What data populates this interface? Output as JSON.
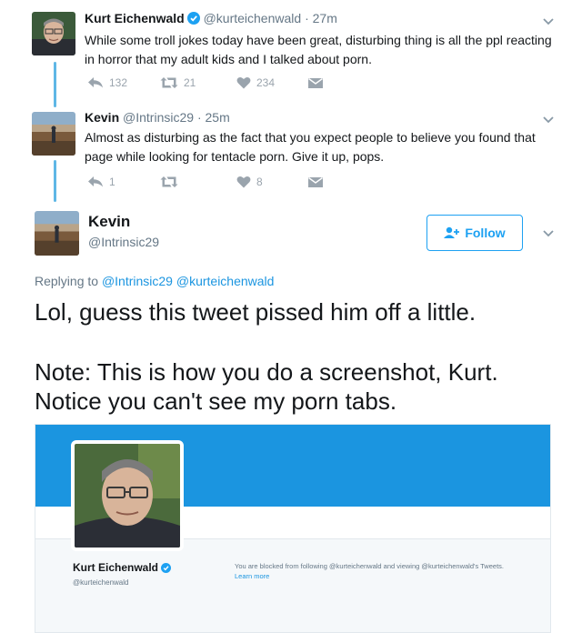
{
  "tweet1": {
    "name": "Kurt Eichenwald",
    "handle": "@kurteichenwald",
    "time": "27m",
    "text": "While some troll jokes today have been great, disturbing thing is all the ppl reacting in horror that my adult kids and I talked about porn.",
    "replies": "132",
    "retweets": "21",
    "likes": "234"
  },
  "tweet2": {
    "name": "Kevin",
    "handle": "@Intrinsic29",
    "time": "25m",
    "text": "Almost as disturbing as the fact that you expect people to believe you found that page while looking for tentacle porn. Give it up, pops.",
    "replies": "1",
    "retweets": "",
    "likes": "8"
  },
  "main_tweet": {
    "name": "Kevin",
    "handle": "@Intrinsic29",
    "follow_label": "Follow",
    "replying_prefix": "Replying to",
    "reply_to_1": "@Intrinsic29",
    "reply_to_2": "@kurteichenwald",
    "text_line1": "Lol, guess this tweet pissed him off a little.",
    "text_line2": "Note: This is how you do a screenshot, Kurt.",
    "text_line3": "Notice you can't see my porn tabs."
  },
  "embedded_card": {
    "name": "Kurt Eichenwald",
    "handle": "@kurteichenwald",
    "blocked_text": "You are blocked from following @kurteichenwald and viewing @kurteichenwald's Tweets.",
    "learn_more": "Learn more"
  },
  "colors": {
    "accent": "#1da1f2",
    "thread_line": "#5fb7e6",
    "banner": "#1b95e0",
    "muted": "#657786"
  },
  "icons": [
    "verified-badge-icon",
    "caret-down-icon",
    "reply-icon",
    "retweet-icon",
    "heart-icon",
    "envelope-icon",
    "follow-person-icon"
  ]
}
